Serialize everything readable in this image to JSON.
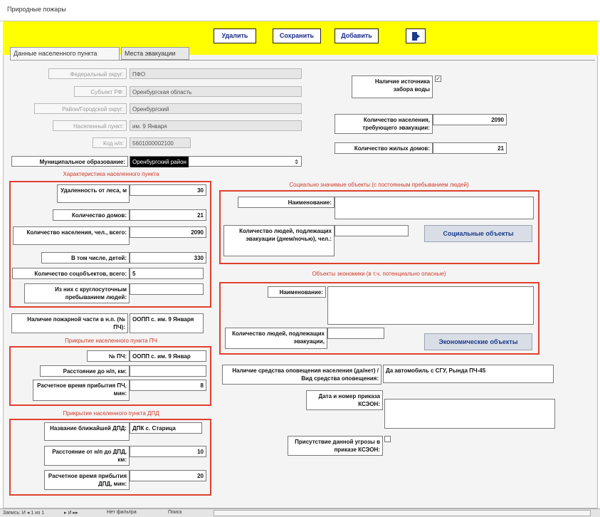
{
  "window": {
    "title": "Природные пожары"
  },
  "toolbar": {
    "delete": "Удалить",
    "save": "Сохранить",
    "add": "Добавить",
    "exit_icon": "exit-door-icon"
  },
  "tabs": [
    {
      "label": "Данные населенного пункта"
    },
    {
      "label": "Места эвакуации"
    }
  ],
  "locality": {
    "federal_district": {
      "label": "Федеральный округ:",
      "value": "ПФО"
    },
    "subject": {
      "label": "Субъект РФ:",
      "value": "Оренбургская область"
    },
    "district": {
      "label": "Район/Городской округ:",
      "value": "Оренбургский"
    },
    "settlement": {
      "label": "Населенный пункт:",
      "value": "им. 9 Января"
    },
    "code": {
      "label": "Код н/п:",
      "value": "5601000002100"
    },
    "municipality": {
      "label": "Муниципальное образование:",
      "value": "Оренбургский район"
    }
  },
  "right_top": {
    "water_source": {
      "label": "Наличие источника забора воды",
      "checked": true
    },
    "evac_population": {
      "label": "Количество населения, требующего эвакуации:",
      "value": "2090"
    },
    "houses": {
      "label": "Количество жилых домов:",
      "value": "21"
    }
  },
  "characteristics": {
    "title": "Характеристика населенного пункта",
    "distance": {
      "label": "Удаленность от леса, м",
      "value": "30"
    },
    "houses": {
      "label": "Количество домов:",
      "value": "21"
    },
    "population": {
      "label": "Количество населения, чел., всего:",
      "value": "2090"
    },
    "children": {
      "label": "В том числе, детей:",
      "value": "330"
    },
    "soc_objects": {
      "label": "Количество соцобъектов, всего:",
      "value": "5"
    },
    "round_clock": {
      "label": "Из них с круглосуточным пребыванием людей:",
      "value": ""
    }
  },
  "fire_station": {
    "label": "Наличие пожарной части в н.п. (№ ПЧ):",
    "value": "ООПП с. им. 9 Января"
  },
  "cover_pch": {
    "title": "Прикрытие населенного пункта ПЧ",
    "number": {
      "label": "№ ПЧ:",
      "value": "ООПП с. им. 9 Январ"
    },
    "distance": {
      "label": "Расстояние до н/п, км:",
      "value": ""
    },
    "time": {
      "label": "Расчетное время прибытия ПЧ, мин:",
      "value": "8"
    }
  },
  "cover_dpd": {
    "title": "Прикрытие населенного пункта ДПД",
    "nearest": {
      "label": "Название ближайшей ДПД:",
      "value": "ДПК с. Старица"
    },
    "distance": {
      "label": "Расстояние от н/п до ДПД, км:",
      "value": "10"
    },
    "time": {
      "label": "Расчетное время прибытия ДПД, мин:",
      "value": "20"
    }
  },
  "social": {
    "title": "Социально значимые объекты (с постоянным пребыванием людей)",
    "name": {
      "label": "Наименование:",
      "value": ""
    },
    "people": {
      "label": "Количество людей, подлежащих эвакуации (днем/ночью), чел.:",
      "value": ""
    },
    "button": "Социальные объекты"
  },
  "economy": {
    "title": "Объекты экономики (в т.ч. потенциально опасные)",
    "name": {
      "label": "Наименование:",
      "value": ""
    },
    "people": {
      "label": "Количество людей, подлежащих эвакуации,",
      "value": ""
    },
    "button": "Экономические объекты"
  },
  "warning": {
    "label": "Наличие средства оповещения населения (да/нет) / Вид средства оповещения:",
    "value": "Да автомобиль с СГУ, Рында ПЧ-45"
  },
  "order": {
    "label": "Дата и номер приказа КСЭОН:",
    "value": ""
  },
  "threat": {
    "label": "Присутствие данной угрозы в приказе КСЭОН:",
    "checked": false
  },
  "statusbar": {
    "record": "Запись: И ◂ 1 из 1",
    "nav": "▸ И ▸▸",
    "filter": "Нет фильтра",
    "search": "Поиск"
  }
}
